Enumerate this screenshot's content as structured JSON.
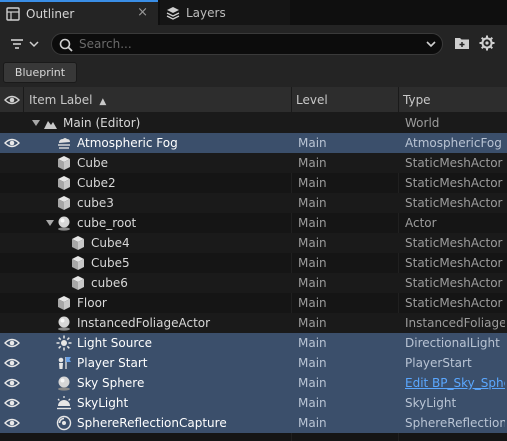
{
  "tabs": [
    {
      "label": "Outliner",
      "close": "×"
    },
    {
      "label": "Layers"
    }
  ],
  "search": {
    "placeholder": "Search..."
  },
  "blueprint_button": "Blueprint",
  "columns": {
    "label": "Item Label",
    "sort": "▲",
    "level": "Level",
    "type": "Type"
  },
  "rows": [
    {
      "name": "Main (Editor)",
      "level": "",
      "type": "World",
      "icon": "world-icon",
      "visible": false,
      "selected": false
    },
    {
      "name": "Atmospheric Fog",
      "level": "Main",
      "type": "AtmosphericFog",
      "icon": "fog-icon",
      "visible": true,
      "selected": true
    },
    {
      "name": "Cube",
      "level": "Main",
      "type": "StaticMeshActor",
      "icon": "cube-icon",
      "visible": false,
      "selected": false
    },
    {
      "name": "Cube2",
      "level": "Main",
      "type": "StaticMeshActor",
      "icon": "cube-icon",
      "visible": false,
      "selected": false
    },
    {
      "name": "cube3",
      "level": "Main",
      "type": "StaticMeshActor",
      "icon": "cube-icon",
      "visible": false,
      "selected": false
    },
    {
      "name": "cube_root",
      "level": "Main",
      "type": "Actor",
      "icon": "actor-icon",
      "visible": false,
      "selected": false
    },
    {
      "name": "Cube4",
      "level": "Main",
      "type": "StaticMeshActor",
      "icon": "cube-icon",
      "visible": false,
      "selected": false
    },
    {
      "name": "Cube5",
      "level": "Main",
      "type": "StaticMeshActor",
      "icon": "cube-icon",
      "visible": false,
      "selected": false
    },
    {
      "name": "cube6",
      "level": "Main",
      "type": "StaticMeshActor",
      "icon": "cube-icon",
      "visible": false,
      "selected": false
    },
    {
      "name": "Floor",
      "level": "Main",
      "type": "StaticMeshActor",
      "icon": "cube-icon",
      "visible": false,
      "selected": false
    },
    {
      "name": "InstancedFoliageActor",
      "level": "Main",
      "type": "InstancedFoliageActor",
      "icon": "actor-icon",
      "visible": false,
      "selected": false
    },
    {
      "name": "Light Source",
      "level": "Main",
      "type": "DirectionalLight",
      "icon": "sun-icon",
      "visible": true,
      "selected": true
    },
    {
      "name": "Player Start",
      "level": "Main",
      "type": "PlayerStart",
      "icon": "flag-icon",
      "visible": true,
      "selected": true
    },
    {
      "name": "Sky Sphere",
      "level": "Main",
      "type": "Edit BP_Sky_Sphere",
      "icon": "actor-icon",
      "visible": true,
      "selected": true,
      "link": true
    },
    {
      "name": "SkyLight",
      "level": "Main",
      "type": "SkyLight",
      "icon": "skylight-icon",
      "visible": true,
      "selected": true
    },
    {
      "name": "SphereReflectionCapture",
      "level": "Main",
      "type": "SphereReflectionCapture",
      "icon": "reflection-icon",
      "visible": true,
      "selected": true
    }
  ],
  "colors": {
    "accent": "#3a8ee6",
    "selection": "#3b4f6b",
    "link": "#5aa7ff"
  }
}
